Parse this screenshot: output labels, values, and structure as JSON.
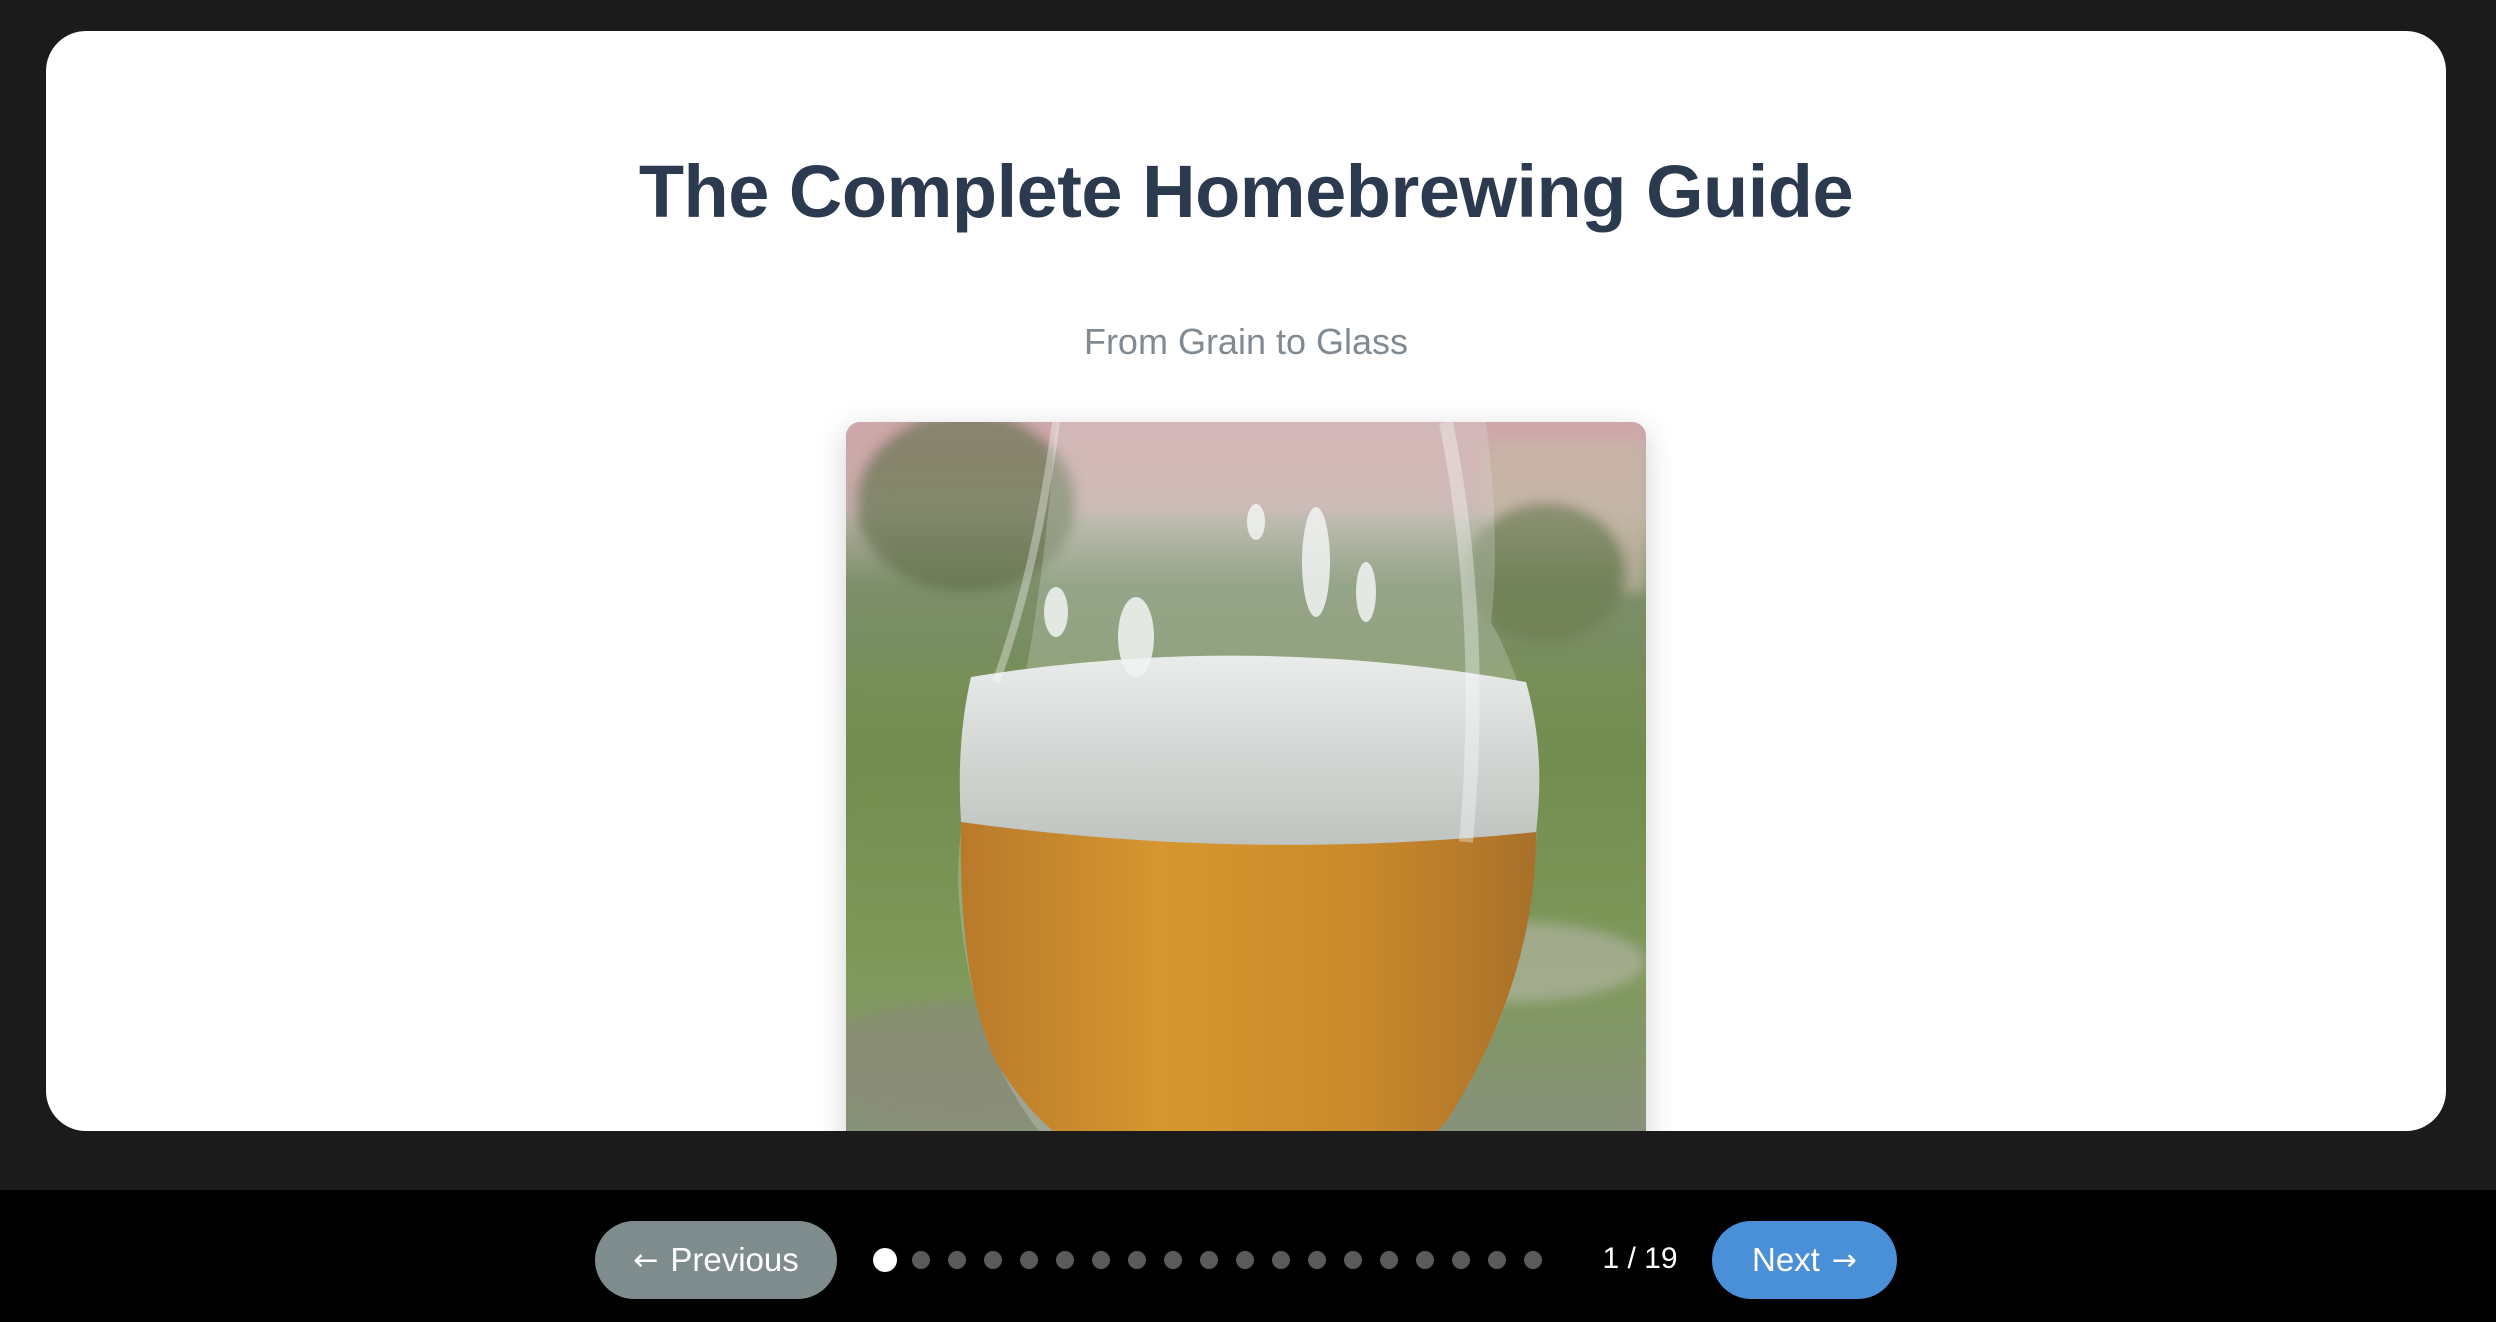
{
  "slide": {
    "title": "The Complete Homebrewing Guide",
    "subtitle": "From Grain to Glass",
    "image_alt": "beer-glass-photo"
  },
  "navigation": {
    "prev_label": "Previous",
    "next_label": "Next",
    "prev_icon": "arrow-left-icon",
    "next_icon": "arrow-right-icon",
    "current_slide": 1,
    "total_slides": 19,
    "counter_text": "1 / 19"
  },
  "colors": {
    "title": "#2c3a4f",
    "subtitle": "#808a93",
    "prev_button": "#7f8c8d",
    "next_button": "#4a90d9",
    "dot_active": "#ffffff",
    "dot_inactive": "#5a5a5a"
  }
}
